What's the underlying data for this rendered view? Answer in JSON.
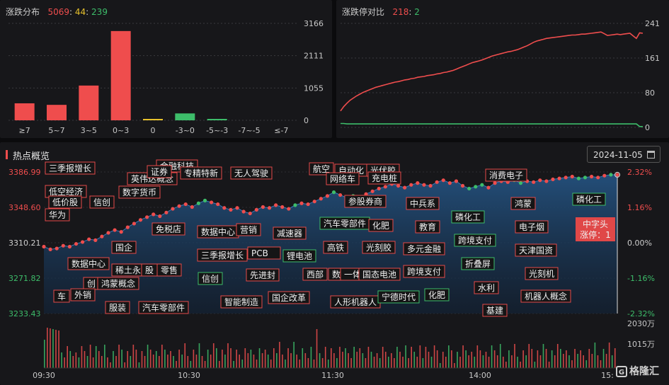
{
  "dist": {
    "title": "涨跌分布",
    "up": "5069",
    "flat": "44",
    "down": "239",
    "sep": ":"
  },
  "ratio": {
    "title": "涨跌停对比",
    "up": "218",
    "down": "2",
    "sep": ":"
  },
  "hot": {
    "title": "热点概览",
    "date": "2024-11-05",
    "callout_line1": "中字头",
    "callout_line2": "涨停：1"
  },
  "colors": {
    "up": "#ef4d4d",
    "down": "#3dbd6a",
    "flat": "#e8c22c",
    "area": "#1d3a5c"
  },
  "logo": "格隆汇",
  "chart_data": [
    {
      "type": "bar",
      "categories": [
        "≥7",
        "5~7",
        "3~5",
        "0~3",
        "0",
        "-3~0",
        "-5~-3",
        "-7~-5",
        "≤-7"
      ],
      "values": [
        555,
        505,
        1135,
        2915,
        44,
        225,
        14,
        0,
        0
      ],
      "yticks": [
        "0",
        "1055",
        "2111",
        "3166"
      ],
      "ylim": [
        0,
        3166
      ]
    },
    {
      "type": "line",
      "yticks": [
        "0",
        "80",
        "161",
        "241"
      ],
      "ylim": [
        0,
        241
      ],
      "series": [
        {
          "color": "up",
          "values": [
            38,
            48,
            56,
            63,
            68,
            73,
            77,
            81,
            84,
            87,
            90,
            93,
            95,
            97,
            99,
            101,
            103,
            105,
            106,
            108,
            110,
            111,
            113,
            114,
            116,
            117,
            118,
            120,
            121,
            122,
            124,
            125,
            127,
            128,
            130,
            132,
            135,
            138,
            141,
            144,
            147,
            150,
            152,
            154,
            156,
            159,
            162,
            165,
            167,
            169,
            171,
            173,
            175,
            176,
            178,
            180,
            183,
            186,
            189,
            193,
            197,
            200,
            202,
            204,
            206,
            207,
            208,
            209,
            210,
            211,
            212,
            213,
            214,
            214,
            215,
            216,
            216,
            217,
            218,
            219,
            220,
            221,
            217,
            213,
            214,
            215,
            216,
            215,
            216,
            217,
            218,
            212,
            206,
            219,
            218
          ]
        },
        {
          "color": "down",
          "values": [
            9,
            9,
            8,
            8,
            8,
            8,
            8,
            8,
            8,
            8,
            8,
            8,
            8,
            8,
            8,
            8,
            8,
            8,
            8,
            8,
            8,
            8,
            8,
            8,
            8,
            8,
            8,
            8,
            8,
            8,
            8,
            8,
            8,
            8,
            8,
            8,
            8,
            8,
            8,
            8,
            8,
            8,
            8,
            8,
            8,
            8,
            8,
            8,
            8,
            8,
            8,
            8,
            8,
            8,
            8,
            8,
            8,
            8,
            8,
            8,
            8,
            8,
            8,
            8,
            8,
            8,
            8,
            8,
            8,
            8,
            8,
            8,
            8,
            8,
            8,
            8,
            8,
            8,
            8,
            8,
            8,
            8,
            8,
            8,
            8,
            8,
            8,
            8,
            8,
            8,
            8,
            8,
            8,
            2,
            2
          ]
        }
      ]
    },
    {
      "type": "area",
      "yticks_left": [
        "3386.99",
        "3348.60",
        "3310.21",
        "3271.82",
        "3233.43"
      ],
      "yticks_right": [
        "2.32%",
        "1.16%",
        "0.00%",
        "-1.16%",
        "-2.32%"
      ],
      "ylim": [
        3233.43,
        3386.99
      ],
      "xticks": [
        "09:30",
        "10:30",
        "11:30",
        "14:00",
        "15:"
      ],
      "vol_ticks": [
        "2030万",
        "1015万"
      ],
      "values": [
        3306,
        3303,
        3304,
        3307,
        3306,
        3309,
        3311,
        3314,
        3313,
        3317,
        3321,
        3324,
        3322,
        3327,
        3331,
        3335,
        3338,
        3341,
        3339,
        3343,
        3347,
        3350,
        3352,
        3349,
        3353,
        3356,
        3354,
        3352,
        3348,
        3346,
        3348,
        3344,
        3342,
        3346,
        3349,
        3348,
        3351,
        3349,
        3347,
        3351,
        3353,
        3352,
        3355,
        3358,
        3361,
        3365,
        3362,
        3359,
        3361,
        3358,
        3363,
        3366,
        3369,
        3371,
        3374,
        3372,
        3370,
        3373,
        3375,
        3373,
        3372,
        3376,
        3378,
        3375,
        3377,
        3372,
        3369,
        3371,
        3373,
        3370,
        3375,
        3377,
        3376,
        3378,
        3375,
        3377,
        3376,
        3378,
        3377,
        3379,
        3380,
        3381,
        3382,
        3380,
        3381,
        3382,
        3381,
        3383,
        3384,
        3384
      ],
      "dot_colors": "rrrrrrrrrrrrrrrrrrrrrrrrggrrrrrrrrrrrrrgrrrrrgrrgrrrrrrrrrrrrrrrrrgggrrrrggrrrrrrrrggrrrgrg",
      "tags": [
        {
          "text": "三季报增长",
          "c": "r"
        },
        {
          "text": "低空经济",
          "c": "r"
        },
        {
          "text": "低价股",
          "c": "r"
        },
        {
          "text": "信创",
          "c": "r"
        },
        {
          "text": "华为",
          "c": "r"
        },
        {
          "text": "数据中心",
          "c": "r"
        },
        {
          "text": "稀土永",
          "c": "r"
        },
        {
          "text": "股",
          "c": "r"
        },
        {
          "text": "零售",
          "c": "r"
        },
        {
          "text": "创",
          "c": "r"
        },
        {
          "text": "鸿蒙概念",
          "c": "r"
        },
        {
          "text": "外销",
          "c": "r"
        },
        {
          "text": "车",
          "c": "r"
        },
        {
          "text": "服装",
          "c": "r"
        },
        {
          "text": "汽车零部件",
          "c": "r"
        },
        {
          "text": "金融科技",
          "c": "r"
        },
        {
          "text": "英伟达概念",
          "c": "r"
        },
        {
          "text": "证券",
          "c": "r"
        },
        {
          "text": "数字货币",
          "c": "r"
        },
        {
          "text": "专精特新",
          "c": "r"
        },
        {
          "text": "无人驾驶",
          "c": "r"
        },
        {
          "text": "免税店",
          "c": "r"
        },
        {
          "text": "国企",
          "c": "r"
        },
        {
          "text": "数据中心",
          "c": "r"
        },
        {
          "text": "营销",
          "c": "r"
        },
        {
          "text": "减速器",
          "c": "r"
        },
        {
          "text": "三季报增长",
          "c": "r"
        },
        {
          "text": "PCB",
          "c": "r"
        },
        {
          "text": "锂电池",
          "c": "g"
        },
        {
          "text": "信创",
          "c": "g"
        },
        {
          "text": "先进封",
          "c": "r"
        },
        {
          "text": "智能制造",
          "c": "r"
        },
        {
          "text": "国企改革",
          "c": "r"
        },
        {
          "text": "航空",
          "c": "r"
        },
        {
          "text": "自动化",
          "c": "r"
        },
        {
          "text": "光伏胶",
          "c": "r"
        },
        {
          "text": "网络车",
          "c": "r"
        },
        {
          "text": "充电桩",
          "c": "r"
        },
        {
          "text": "参股券商",
          "c": "r"
        },
        {
          "text": "汽车零部件",
          "c": "g"
        },
        {
          "text": "化肥",
          "c": "r"
        },
        {
          "text": "高铁",
          "c": "r"
        },
        {
          "text": "光刻胶",
          "c": "r"
        },
        {
          "text": "西部",
          "c": "r"
        },
        {
          "text": "数",
          "c": "r"
        },
        {
          "text": "一体",
          "c": "r"
        },
        {
          "text": "国态电池",
          "c": "r"
        },
        {
          "text": "人形机器人",
          "c": "r"
        },
        {
          "text": "宁德时代",
          "c": "g"
        },
        {
          "text": "中兵系",
          "c": "r"
        },
        {
          "text": "教育",
          "c": "r"
        },
        {
          "text": "多元金融",
          "c": "r"
        },
        {
          "text": "跨境支付",
          "c": "r"
        },
        {
          "text": "化肥",
          "c": "g"
        },
        {
          "text": "磷化工",
          "c": "g"
        },
        {
          "text": "跨境支付",
          "c": "g"
        },
        {
          "text": "折叠屏",
          "c": "g"
        },
        {
          "text": "水利",
          "c": "r"
        },
        {
          "text": "基建",
          "c": "r"
        },
        {
          "text": "消费电子",
          "c": "r"
        },
        {
          "text": "鸿蒙",
          "c": "r"
        },
        {
          "text": "电子烟",
          "c": "r"
        },
        {
          "text": "天津国资",
          "c": "r"
        },
        {
          "text": "光刻机",
          "c": "r"
        },
        {
          "text": "机器人概念",
          "c": "r"
        },
        {
          "text": "磷化工",
          "c": "g"
        }
      ]
    }
  ]
}
